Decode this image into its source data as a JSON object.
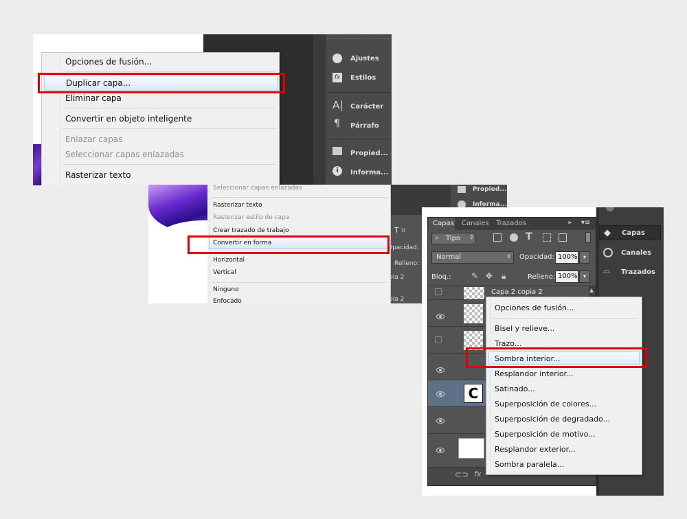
{
  "shot1": {
    "menu_items": [
      "Opciones de fusión...",
      "Duplicar capa...",
      "Eliminar capa",
      "Convertir en objeto inteligente",
      "Enlazar capas",
      "Seleccionar capas enlazadas",
      "Rasterizar texto"
    ],
    "side_panel": [
      "Ajustes",
      "Estilos",
      "Carácter",
      "Párrafo",
      "Propied...",
      "Informa..."
    ]
  },
  "shot2": {
    "menu_items": [
      "Seleccionar capas enlazadas",
      "Rasterizar texto",
      "Rasterizar estilo de capa",
      "Crear trazado de trabajo",
      "Convertir en forma",
      "Horizontal",
      "Vertical",
      "Ninguno",
      "Enfocado"
    ],
    "side_panel": [
      "Propied...",
      "Informa..."
    ],
    "opacity_label": "Opacidad:",
    "fill_label": "Relleno:",
    "layer_fragments": [
      "pia 2",
      "pia 2"
    ]
  },
  "shot3": {
    "tabs": [
      "Capas",
      "Canales",
      "Trazados"
    ],
    "filter_label": "Tipo",
    "blend_mode": "Normal",
    "opacity_label": "Opacidad:",
    "opacity_value": "100%",
    "lock_label": "Bloq.:",
    "fill_label": "Relleno:",
    "fill_value": "100%",
    "top_layer": "Capa 2 copia 2",
    "context_menu": [
      "Opciones de fusión...",
      "Bisel y relieve...",
      "Trazo...",
      "Sombra interior...",
      "Resplandor interior...",
      "Satinado...",
      "Superposición de colores...",
      "Superposición de degradado...",
      "Superposición de motivo...",
      "Resplandor exterior...",
      "Sombra paralela..."
    ],
    "side_panel": [
      "Capas",
      "Canales",
      "Trazados"
    ]
  }
}
